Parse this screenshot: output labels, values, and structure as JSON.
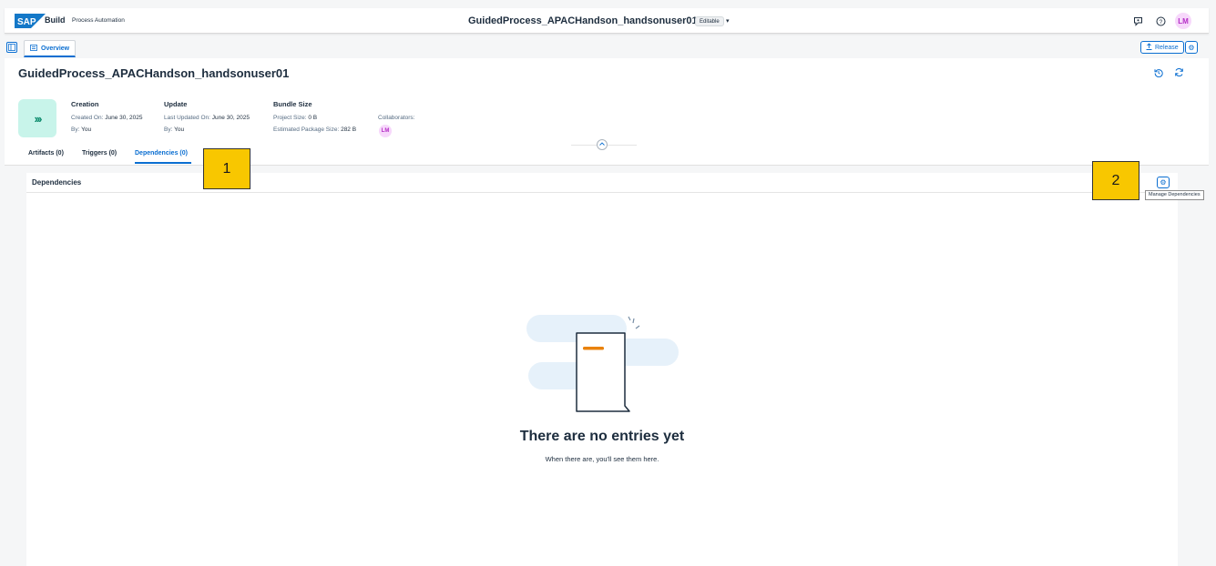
{
  "shell": {
    "logo_text": "SAP",
    "brand": "Build",
    "product": "Process Automation",
    "app_title": "GuidedProcess_APACHandson_handsonuser01",
    "editable_badge": "Editable",
    "caret": "▾",
    "avatar_initials": "LM",
    "icons": [
      "feedback-icon",
      "help-icon"
    ]
  },
  "tabbar": {
    "overview_tab": "Overview",
    "release_button": "Release"
  },
  "header": {
    "title": "GuidedProcess_APACHandson_handsonuser01",
    "creation": {
      "title": "Creation",
      "created_on_label": "Created On:",
      "created_on_value": "June 30, 2025",
      "by_label": "By:",
      "by_value": "You"
    },
    "update": {
      "title": "Update",
      "updated_on_label": "Last Updated On:",
      "updated_on_value": "June 30, 2025",
      "by_label": "By:",
      "by_value": "You"
    },
    "bundle": {
      "title": "Bundle Size",
      "project_size_label": "Project Size:",
      "project_size_value": "0 B",
      "package_size_label": "Estimated Package Size:",
      "package_size_value": "282 B"
    },
    "collaborators_label": "Collaborators:",
    "collaborator_initials": "LM"
  },
  "subtabs": [
    {
      "label": "Artifacts (0)"
    },
    {
      "label": "Triggers (0)"
    },
    {
      "label": "Dependencies (0)",
      "selected": true
    }
  ],
  "dependencies": {
    "title": "Dependencies",
    "manage_tooltip": "Manage Dependencies",
    "empty_title": "There are no entries yet",
    "empty_subtitle": "When there are, you'll see them here."
  },
  "callouts": [
    "1",
    "2"
  ],
  "colors": {
    "accent": "#0a6ed1",
    "callout": "#f8c700",
    "tile_bg": "#c8f4ea",
    "avatar_bg": "#f7d8fb"
  }
}
